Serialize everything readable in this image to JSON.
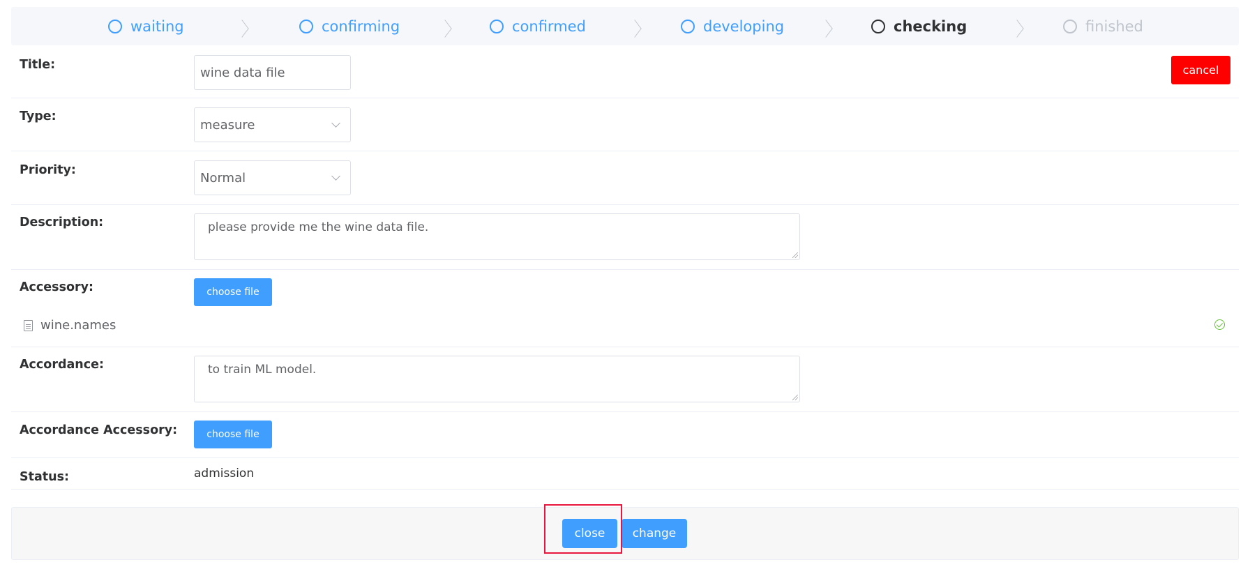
{
  "steps": [
    {
      "label": "waiting",
      "state": "done"
    },
    {
      "label": "confirming",
      "state": "done"
    },
    {
      "label": "confirmed",
      "state": "done"
    },
    {
      "label": "developing",
      "state": "done"
    },
    {
      "label": "checking",
      "state": "active"
    },
    {
      "label": "finished",
      "state": "wait"
    }
  ],
  "form": {
    "title": {
      "label": "Title:",
      "value": "wine data file"
    },
    "type": {
      "label": "Type:",
      "value": "measure"
    },
    "priority": {
      "label": "Priority:",
      "value": "Normal"
    },
    "description": {
      "label": "Description:",
      "value": "please provide me the wine data file."
    },
    "accessory": {
      "label": "Accessory:",
      "button": "choose file",
      "files": [
        {
          "name": "wine.names",
          "icon": "document-icon",
          "status_icon": "check-circle-icon"
        }
      ]
    },
    "accordance": {
      "label": "Accordance:",
      "value": "to train ML model."
    },
    "accordance_accessory": {
      "label": "Accordance Accessory:",
      "button": "choose file"
    },
    "status": {
      "label": "Status:",
      "value": "admission"
    }
  },
  "actions": {
    "cancel": "cancel",
    "close": "close",
    "change": "change"
  },
  "colors": {
    "primary": "#409eff",
    "danger": "#ff0000",
    "success": "#67c23a",
    "highlight": "#e8153d"
  }
}
